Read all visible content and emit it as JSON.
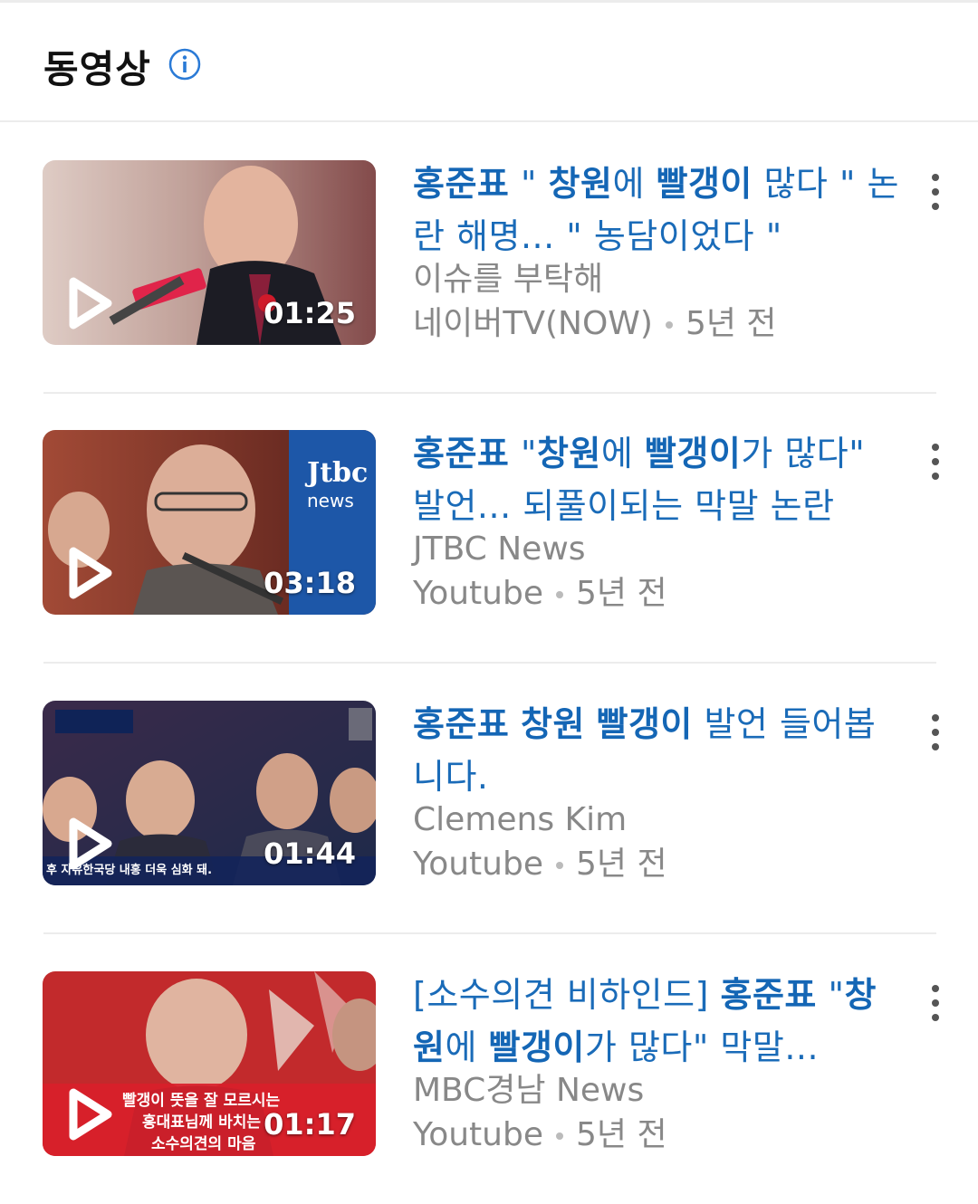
{
  "header": {
    "title": "동영상",
    "info_icon": "info-icon"
  },
  "videos": [
    {
      "title_parts": [
        {
          "text": "홍준표",
          "bold": true
        },
        {
          "text": " \" ",
          "bold": false
        },
        {
          "text": "창원",
          "bold": true
        },
        {
          "text": "에 ",
          "bold": false
        },
        {
          "text": "빨갱이",
          "bold": true
        },
        {
          "text": " 많다 \" 논란 해명... \" 농담이었다 \"",
          "bold": false
        }
      ],
      "source": "이슈를 부탁해",
      "platform": "네이버TV(NOW)",
      "age": "5년 전",
      "duration": "01:25",
      "thumb_colors": [
        "#c7b2a8",
        "#6b3a36"
      ]
    },
    {
      "title_parts": [
        {
          "text": "홍준표",
          "bold": true
        },
        {
          "text": " \"",
          "bold": false
        },
        {
          "text": "창원",
          "bold": true
        },
        {
          "text": "에 ",
          "bold": false
        },
        {
          "text": "빨갱이",
          "bold": true
        },
        {
          "text": "가 많다\" 발언... 되풀이되는 막말 논란",
          "bold": false
        }
      ],
      "source": "JTBC News",
      "platform": "Youtube",
      "age": "5년 전",
      "duration": "03:18",
      "thumb_colors": [
        "#8a3b2c",
        "#1d4f9a"
      ],
      "logo_text_1": "Jtbc",
      "logo_text_2": "news"
    },
    {
      "title_parts": [
        {
          "text": "홍준표",
          "bold": true
        },
        {
          "text": " ",
          "bold": false
        },
        {
          "text": "창원",
          "bold": true
        },
        {
          "text": " ",
          "bold": false
        },
        {
          "text": "빨갱이",
          "bold": true
        },
        {
          "text": " 발언 들어봅니다.",
          "bold": false
        }
      ],
      "source": "Clemens Kim",
      "platform": "Youtube",
      "age": "5년 전",
      "duration": "01:44",
      "thumb_colors": [
        "#2b3d6b",
        "#7a4a3e"
      ],
      "caption": "후 자유한국당 내홍 더욱 심화 돼."
    },
    {
      "title_parts": [
        {
          "text": "[소수의견 비하인드] ",
          "bold": false
        },
        {
          "text": "홍준표",
          "bold": true
        },
        {
          "text": " \"",
          "bold": false
        },
        {
          "text": "창원",
          "bold": true
        },
        {
          "text": "에 ",
          "bold": false
        },
        {
          "text": "빨갱이",
          "bold": true
        },
        {
          "text": "가 많다\" 막말...",
          "bold": false
        }
      ],
      "source": "MBC경남 News",
      "platform": "Youtube",
      "age": "5년 전",
      "duration": "01:17",
      "thumb_colors": [
        "#c8282a",
        "#5a1414"
      ],
      "caption_lines": [
        "빨갱이 뜻을 잘 모르시는",
        "홍대표님께 바치는",
        "소수의견의 마음"
      ]
    }
  ]
}
